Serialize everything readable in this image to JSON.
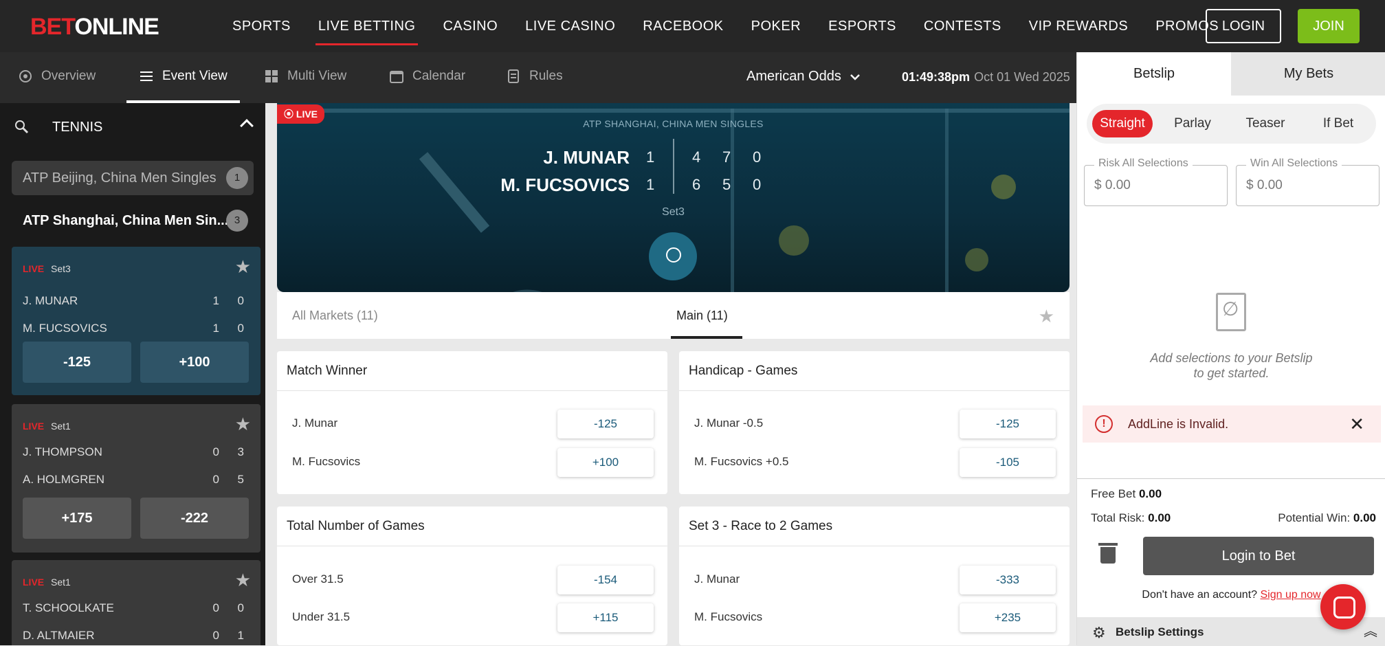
{
  "brand": {
    "bet": "BET",
    "online": "ONLINE"
  },
  "nav": [
    "SPORTS",
    "LIVE BETTING",
    "CASINO",
    "LIVE CASINO",
    "RACEBOOK",
    "POKER",
    "ESPORTS",
    "CONTESTS",
    "VIP REWARDS",
    "PROMOS"
  ],
  "auth": {
    "login": "LOGIN",
    "join": "JOIN"
  },
  "subnav": {
    "tabs": [
      "Overview",
      "Event View",
      "Multi View",
      "Calendar",
      "Rules"
    ],
    "odds_format": "American Odds",
    "time": "01:49:38pm",
    "date": "Oct 01 Wed 2025"
  },
  "sidebar": {
    "sport": "TENNIS",
    "leagues": [
      {
        "name": "ATP Beijing, China Men Singles",
        "count": "1"
      },
      {
        "name": "ATP Shanghai, China Men Sin...",
        "count": "3"
      }
    ],
    "matches": [
      {
        "live": "LIVE",
        "set": "Set3",
        "p1": "J. MUNAR",
        "p1_s1": "1",
        "p1_s2": "0",
        "p2": "M. FUCSOVICS",
        "p2_s1": "1",
        "p2_s2": "0",
        "odds1": "-125",
        "odds2": "+100"
      },
      {
        "live": "LIVE",
        "set": "Set1",
        "p1": "J. THOMPSON",
        "p1_s1": "0",
        "p1_s2": "3",
        "p2": "A. HOLMGREN",
        "p2_s1": "0",
        "p2_s2": "5",
        "odds1": "+175",
        "odds2": "-222"
      },
      {
        "live": "LIVE",
        "set": "Set1",
        "p1": "T. SCHOOLKATE",
        "p1_s1": "0",
        "p1_s2": "0",
        "p2": "D. ALTMAIER",
        "p2_s1": "0",
        "p2_s2": "1"
      }
    ]
  },
  "event": {
    "live": "LIVE",
    "competition": "ATP SHANGHAI, CHINA MEN SINGLES",
    "p1": "J. MUNAR",
    "p1_sets": "1",
    "p1_g1": "4",
    "p1_g2": "7",
    "p1_g3": "0",
    "p2": "M. FUCSOVICS",
    "p2_sets": "1",
    "p2_g1": "6",
    "p2_g2": "5",
    "p2_g3": "0",
    "set_label": "Set3"
  },
  "market_tabs": {
    "all": "All Markets (11)",
    "main": "Main (11)"
  },
  "markets": [
    {
      "title": "Match Winner",
      "rows": [
        {
          "label": "J. Munar",
          "odds": "-125"
        },
        {
          "label": "M. Fucsovics",
          "odds": "+100"
        }
      ]
    },
    {
      "title": "Handicap - Games",
      "rows": [
        {
          "label": "J. Munar -0.5",
          "odds": "-125"
        },
        {
          "label": "M. Fucsovics +0.5",
          "odds": "-105"
        }
      ]
    },
    {
      "title": "Total Number of Games",
      "rows": [
        {
          "label": "Over 31.5",
          "odds": "-154"
        },
        {
          "label": "Under 31.5",
          "odds": "+115"
        }
      ]
    },
    {
      "title": "Set 3 - Race to 2 Games",
      "rows": [
        {
          "label": "J. Munar",
          "odds": "-333"
        },
        {
          "label": "M. Fucsovics",
          "odds": "+235"
        }
      ]
    }
  ],
  "betslip": {
    "tabs": [
      "Betslip",
      "My Bets"
    ],
    "bet_types": [
      "Straight",
      "Parlay",
      "Teaser",
      "If Bet"
    ],
    "risk_label": "Risk All Selections",
    "risk_value": "$ 0.00",
    "win_label": "Win All Selections",
    "win_value": "$ 0.00",
    "empty_line1": "Add selections to your Betslip",
    "empty_line2": "to get started.",
    "alert": "AddLine is Invalid.",
    "free_bet_label": "Free Bet",
    "free_bet": "0.00",
    "total_risk_label": "Total Risk:",
    "total_risk": "0.00",
    "potential_win_label": "Potential Win:",
    "potential_win": "0.00",
    "login_to_bet": "Login to Bet",
    "no_account": "Don't have an account?",
    "signup": "Sign up now",
    "settings": "Betslip Settings"
  },
  "colors": {
    "brand_red": "#e4262b",
    "join_green": "#7cbd1a",
    "odds_blue": "#1a5a79"
  }
}
